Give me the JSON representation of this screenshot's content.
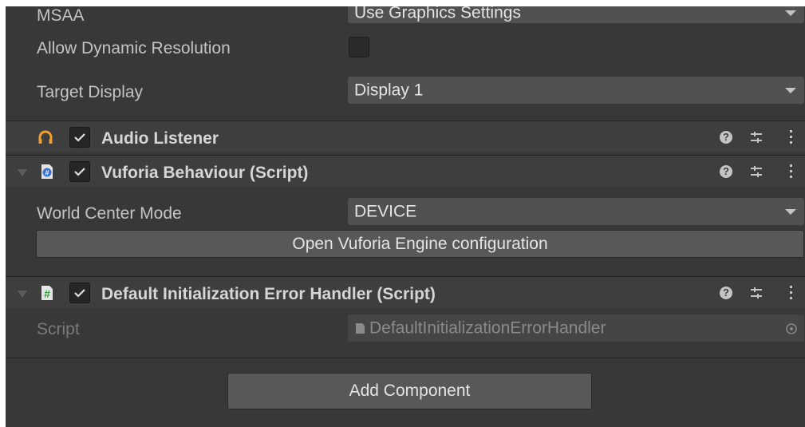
{
  "camera": {
    "msaa_label": "MSAA",
    "msaa_value": "Use Graphics Settings",
    "dynamic_res_label": "Allow Dynamic Resolution",
    "target_display_label": "Target Display",
    "target_display_value": "Display 1"
  },
  "components": [
    {
      "title": "Audio Listener",
      "icon": "headphones-icon",
      "enabled": true
    },
    {
      "title": "Vuforia Behaviour (Script)",
      "icon": "csharp-script-icon",
      "enabled": true
    },
    {
      "title": "Default Initialization Error Handler (Script)",
      "icon": "hash-script-icon",
      "enabled": true
    }
  ],
  "vuforia": {
    "world_center_label": "World Center Mode",
    "world_center_value": "DEVICE",
    "open_config_label": "Open Vuforia Engine configuration"
  },
  "error_handler": {
    "script_label": "Script",
    "script_value": "DefaultInitializationErrorHandler"
  },
  "add_component_label": "Add Component",
  "colors": {
    "background": "#383838",
    "header": "#3e3e3e",
    "field": "#515151",
    "accent_orange": "#f0a030"
  }
}
